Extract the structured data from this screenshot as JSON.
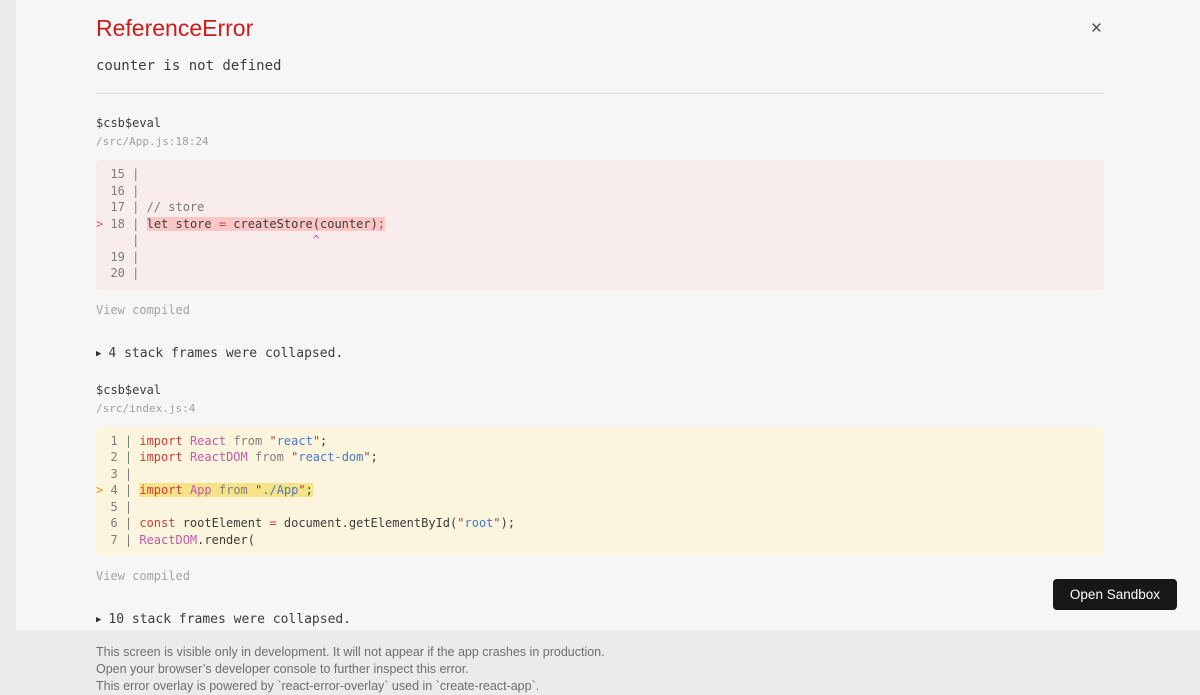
{
  "overlay": {
    "title": "ReferenceError",
    "message": "counter is not defined",
    "close_label": "×"
  },
  "frames": [
    {
      "fn": "$csb$eval",
      "location": "/src/App.js:18:24",
      "variant": "error",
      "view_compiled": "View compiled",
      "lines": [
        {
          "segments": [
            {
              "t": "  15 | ",
              "c": "gutter"
            }
          ]
        },
        {
          "segments": [
            {
              "t": "  16 | ",
              "c": "gutter"
            }
          ]
        },
        {
          "segments": [
            {
              "t": "  17 | ",
              "c": "gutter"
            },
            {
              "t": "// store",
              "c": "comment"
            }
          ]
        },
        {
          "segments": [
            {
              "t": ">",
              "c": "marker-err"
            },
            {
              "t": " 18 | ",
              "c": "gutter"
            },
            {
              "t": "let store ",
              "c": "plain",
              "hl": true
            },
            {
              "t": "=",
              "c": "op",
              "hl": true
            },
            {
              "t": " createStore(counter)",
              "c": "plain",
              "hl": true
            },
            {
              "t": ";",
              "c": "op",
              "hl": true
            }
          ]
        },
        {
          "segments": [
            {
              "t": "     | ",
              "c": "gutter"
            },
            {
              "t": "                       ",
              "c": "plain"
            },
            {
              "t": "^",
              "c": "caret"
            }
          ]
        },
        {
          "segments": [
            {
              "t": "  19 | ",
              "c": "gutter"
            }
          ]
        },
        {
          "segments": [
            {
              "t": "  20 | ",
              "c": "gutter"
            }
          ]
        }
      ]
    },
    {
      "fn": "$csb$eval",
      "location": "/src/index.js:4",
      "variant": "warn",
      "view_compiled": "View compiled",
      "lines": [
        {
          "segments": [
            {
              "t": "  1 | ",
              "c": "gutter"
            },
            {
              "t": "import",
              "c": "keyword"
            },
            {
              "t": " ",
              "c": "plain"
            },
            {
              "t": "React",
              "c": "cap"
            },
            {
              "t": " ",
              "c": "plain"
            },
            {
              "t": "from",
              "c": "mod"
            },
            {
              "t": " ",
              "c": "plain"
            },
            {
              "t": "\"",
              "c": "quote"
            },
            {
              "t": "react",
              "c": "str"
            },
            {
              "t": "\"",
              "c": "quote"
            },
            {
              "t": ";",
              "c": "plain"
            }
          ]
        },
        {
          "segments": [
            {
              "t": "  2 | ",
              "c": "gutter"
            },
            {
              "t": "import",
              "c": "keyword"
            },
            {
              "t": " ",
              "c": "plain"
            },
            {
              "t": "ReactDOM",
              "c": "cap"
            },
            {
              "t": " ",
              "c": "plain"
            },
            {
              "t": "from",
              "c": "mod"
            },
            {
              "t": " ",
              "c": "plain"
            },
            {
              "t": "\"",
              "c": "quote"
            },
            {
              "t": "react-dom",
              "c": "str"
            },
            {
              "t": "\"",
              "c": "quote"
            },
            {
              "t": ";",
              "c": "plain"
            }
          ]
        },
        {
          "segments": [
            {
              "t": "  3 | ",
              "c": "gutter"
            }
          ]
        },
        {
          "segments": [
            {
              "t": ">",
              "c": "marker-warn"
            },
            {
              "t": " 4 | ",
              "c": "gutter"
            },
            {
              "t": "import",
              "c": "keyword",
              "hl": true
            },
            {
              "t": " ",
              "c": "plain",
              "hl": true
            },
            {
              "t": "App",
              "c": "cap",
              "hl": true
            },
            {
              "t": " ",
              "c": "plain",
              "hl": true
            },
            {
              "t": "from",
              "c": "mod",
              "hl": true
            },
            {
              "t": " ",
              "c": "plain",
              "hl": true
            },
            {
              "t": "\"",
              "c": "quote",
              "hl": true
            },
            {
              "t": "./App",
              "c": "str",
              "hl": true
            },
            {
              "t": "\"",
              "c": "quote",
              "hl": true
            },
            {
              "t": ";",
              "c": "plain",
              "hl": true
            }
          ]
        },
        {
          "segments": [
            {
              "t": "  5 | ",
              "c": "gutter"
            }
          ]
        },
        {
          "segments": [
            {
              "t": "  6 | ",
              "c": "gutter"
            },
            {
              "t": "const",
              "c": "keyword"
            },
            {
              "t": " rootElement ",
              "c": "plain"
            },
            {
              "t": "=",
              "c": "op"
            },
            {
              "t": " document.getElementById(",
              "c": "plain"
            },
            {
              "t": "\"",
              "c": "quote"
            },
            {
              "t": "root",
              "c": "str"
            },
            {
              "t": "\"",
              "c": "quote"
            },
            {
              "t": ");",
              "c": "plain"
            }
          ]
        },
        {
          "segments": [
            {
              "t": "  7 | ",
              "c": "gutter"
            },
            {
              "t": "ReactDOM",
              "c": "cap"
            },
            {
              "t": ".render(",
              "c": "plain"
            }
          ]
        }
      ]
    }
  ],
  "collapsed": [
    {
      "icon": "▶",
      "text": "4 stack frames were collapsed."
    },
    {
      "icon": "▶",
      "text": "10 stack frames were collapsed."
    }
  ],
  "footer": {
    "lines": [
      "This screen is visible only in development. It will not appear if the app crashes in production.",
      "Open your browser’s developer console to further inspect this error.",
      "This error overlay is powered by `react-error-overlay` used in `create-react-app`."
    ],
    "open_sandbox_label": "Open Sandbox"
  },
  "colors": {
    "title_red": "#d01b1b",
    "frame_error_bg": "#f8ecec",
    "frame_error_highlight": "#fbc6c6",
    "frame_warn_bg": "#faf5dc",
    "frame_warn_highlight": "#f6e388",
    "button_bg": "#171717"
  }
}
